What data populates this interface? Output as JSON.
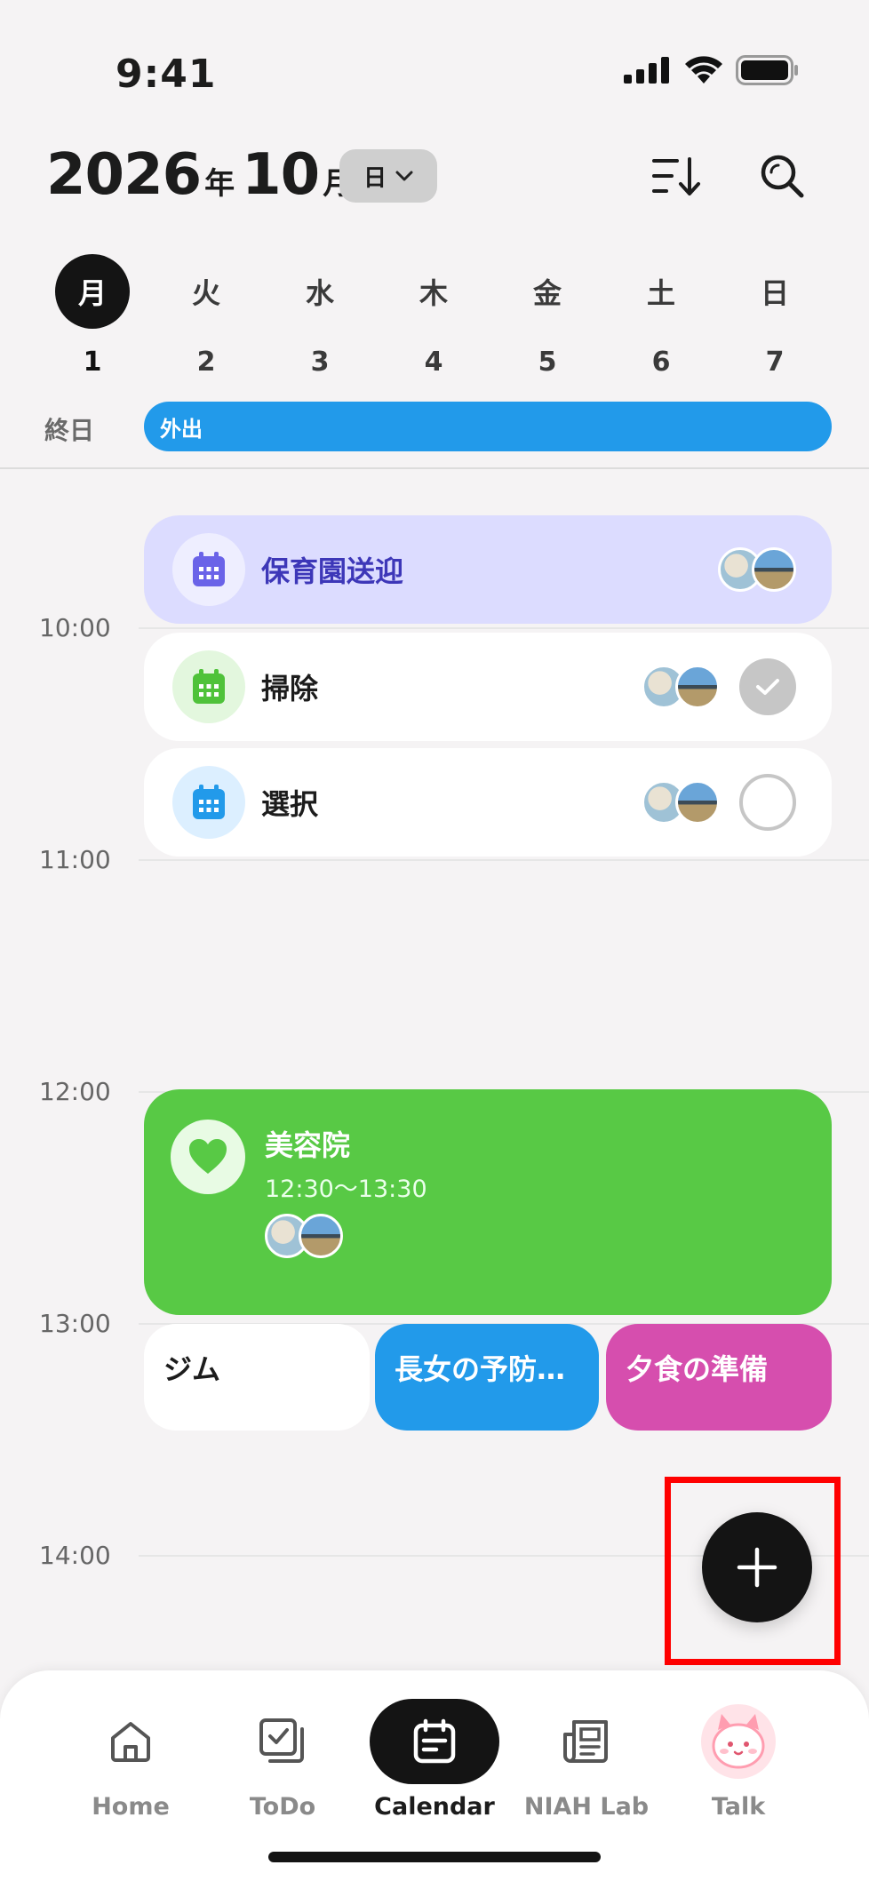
{
  "status": {
    "time": "9:41"
  },
  "header": {
    "year": "2026",
    "year_unit": "年",
    "month": "10",
    "month_unit": "月",
    "view_mode": "日",
    "sort_icon": "sort-icon",
    "search_icon": "search-icon"
  },
  "week": [
    {
      "name": "月",
      "num": "1",
      "active": true
    },
    {
      "name": "火",
      "num": "2",
      "active": false
    },
    {
      "name": "水",
      "num": "3",
      "active": false
    },
    {
      "name": "木",
      "num": "4",
      "active": false
    },
    {
      "name": "金",
      "num": "5",
      "active": false
    },
    {
      "name": "土",
      "num": "6",
      "active": false
    },
    {
      "name": "日",
      "num": "7",
      "active": false
    }
  ],
  "all_day": {
    "label": "終日",
    "event": "外出",
    "color": "#229aea"
  },
  "time_labels": [
    "10:00",
    "11:00",
    "12:00",
    "13:00",
    "14:00"
  ],
  "events": {
    "pickup": {
      "title": "保育園送迎",
      "color": "#dcdcff",
      "icon": "calendar-icon"
    },
    "cleaning": {
      "title": "掃除",
      "done": true,
      "icon": "calendar-icon"
    },
    "selection": {
      "title": "選択",
      "done": false,
      "icon": "calendar-icon"
    },
    "salon": {
      "title": "美容院",
      "time": "12:30～13:30",
      "color": "#58c945",
      "icon": "heart-icon"
    },
    "gym": {
      "title": "ジム",
      "color": "#ffffff"
    },
    "vaccine": {
      "title": "長女の予防…",
      "color": "#229aea"
    },
    "dinner": {
      "title": "夕食の準備",
      "color": "#d64eae"
    }
  },
  "fab": {
    "icon": "plus-icon"
  },
  "nav": [
    {
      "label": "Home",
      "icon": "home-icon",
      "active": false
    },
    {
      "label": "ToDo",
      "icon": "todo-icon",
      "active": false
    },
    {
      "label": "Calendar",
      "icon": "calendar-icon",
      "active": true
    },
    {
      "label": "NIAH Lab",
      "icon": "news-icon",
      "active": false
    },
    {
      "label": "Talk",
      "icon": "mascot-icon",
      "active": false
    }
  ]
}
